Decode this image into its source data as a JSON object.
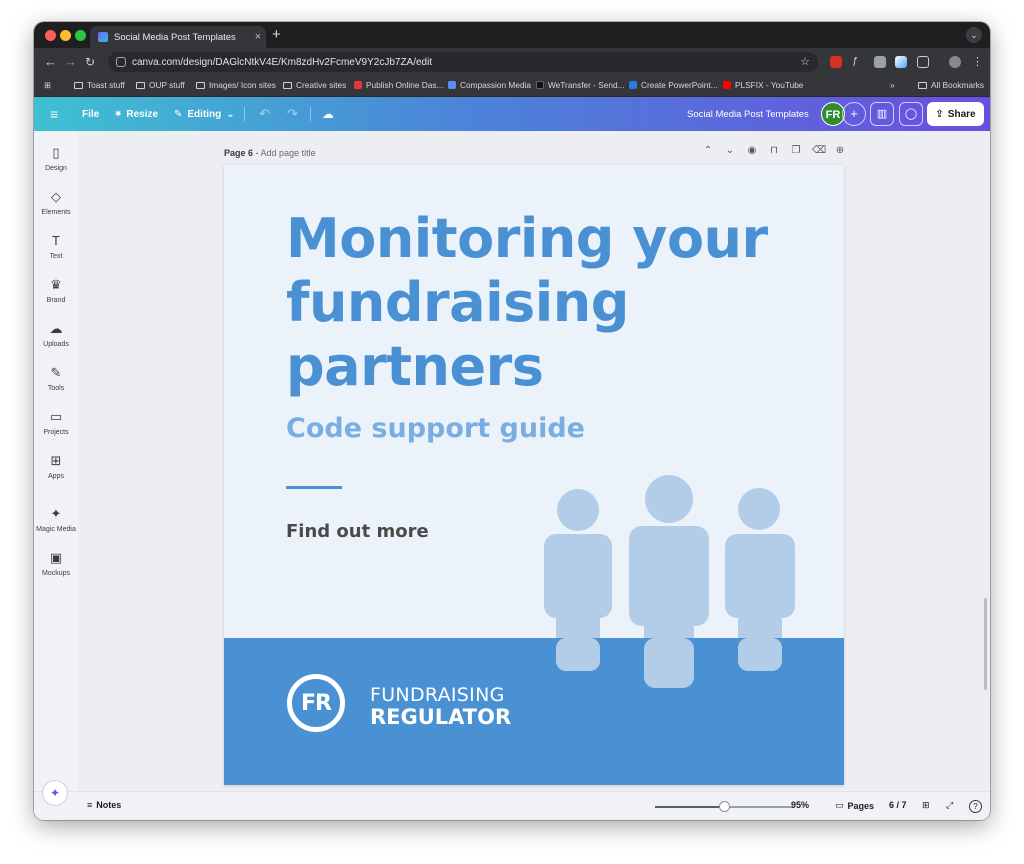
{
  "browser": {
    "tab_title": "Social Media Post Templates",
    "tab_close": "×",
    "new_tab": "+",
    "url": "canva.com/design/DAGlcNtkV4E/Km8zdHv2FcmeV9Y2cJb7ZA/edit",
    "bookmarks": [
      "Toast stuff",
      "OUP stuff",
      "Images/ Icon sites",
      "Creative sites",
      "Publish Online Das...",
      "Compassion Media",
      "WeTransfer - Send...",
      "Create PowerPoint...",
      "PLSFIX - YouTube"
    ],
    "bookmarks_overflow": "»",
    "all_bookmarks": "All Bookmarks"
  },
  "canva_header": {
    "menu_icon": "≡",
    "file": "File",
    "resize": "Resize",
    "editing": "Editing",
    "design_title": "Social Media Post Templates",
    "avatar_initials": "FR",
    "share": "Share"
  },
  "sidebar": {
    "items": [
      {
        "label": "Design",
        "icon": "▯"
      },
      {
        "label": "Elements",
        "icon": "◇"
      },
      {
        "label": "Text",
        "icon": "T"
      },
      {
        "label": "Brand",
        "icon": "♛"
      },
      {
        "label": "Uploads",
        "icon": "☁"
      },
      {
        "label": "Tools",
        "icon": "✎"
      },
      {
        "label": "Projects",
        "icon": "▭"
      },
      {
        "label": "Apps",
        "icon": "⊞"
      },
      {
        "label": "Magic Media",
        "icon": "✦"
      },
      {
        "label": "Mockups",
        "icon": "▣"
      }
    ]
  },
  "editor": {
    "page_number": "Page 6",
    "page_title_hint": "Add page title"
  },
  "design": {
    "headline": "Monitoring your fundraising partners",
    "subhead": "Code support guide",
    "cta": "Find out more",
    "logo_initials": "FR",
    "logo_line1": "FUNDRAISING",
    "logo_line2": "REGULATOR"
  },
  "footer": {
    "notes": "Notes",
    "zoom": "95%",
    "zoom_fraction": 0.5,
    "pages": "Pages",
    "page_count": "6 / 7",
    "help": "?"
  },
  "colors": {
    "brand_blue": "#4a91d4",
    "light_blue": "#7aaee1",
    "canvas_bg": "#ebf2fa",
    "figure_blue": "#b3cde9"
  }
}
